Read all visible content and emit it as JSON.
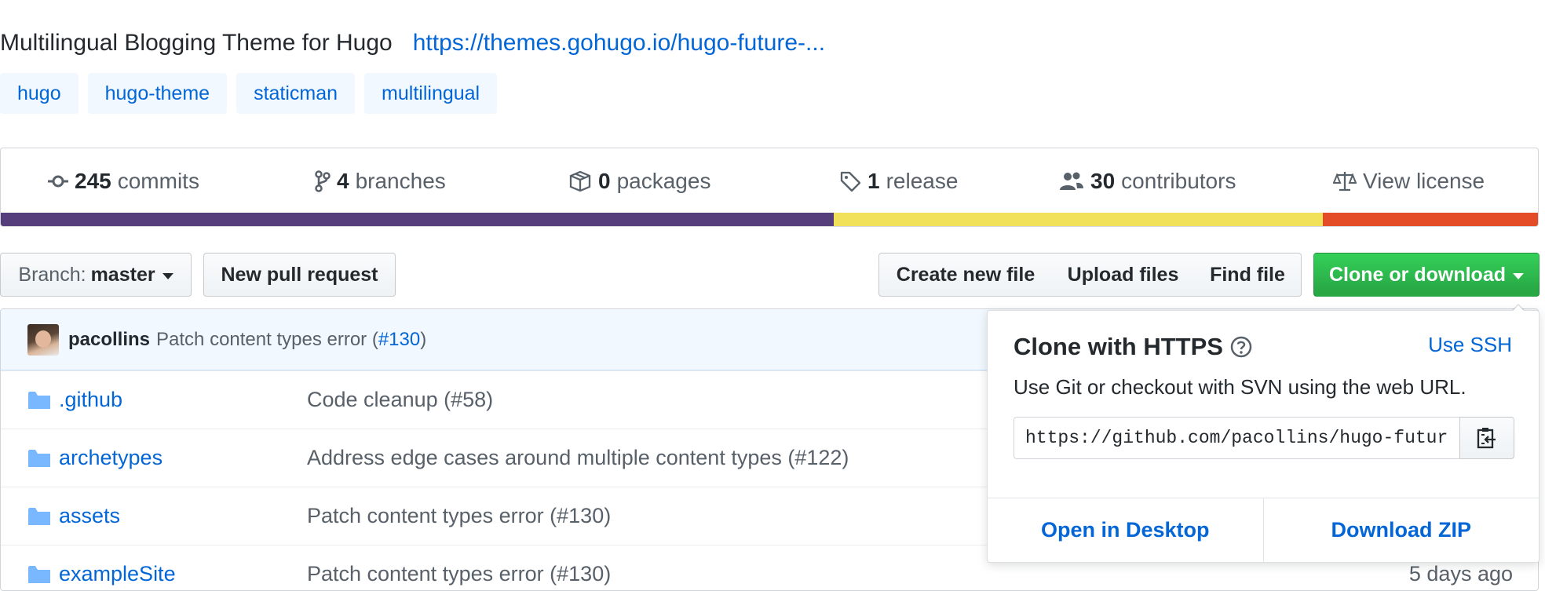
{
  "repo": {
    "description": "Multilingual Blogging Theme for Hugo",
    "website": "https://themes.gohugo.io/hugo-future-..."
  },
  "topics": [
    "hugo",
    "hugo-theme",
    "staticman",
    "multilingual"
  ],
  "summary": {
    "commits": {
      "count": "245",
      "label": "commits"
    },
    "branches": {
      "count": "4",
      "label": "branches"
    },
    "packages": {
      "count": "0",
      "label": "packages"
    },
    "releases": {
      "count": "1",
      "label": "release"
    },
    "contributors": {
      "count": "30",
      "label": "contributors"
    },
    "license": {
      "label": "View license"
    }
  },
  "language_bar": [
    {
      "color": "#563d7c",
      "percent": 54.2
    },
    {
      "color": "#f1e05a",
      "percent": 31.8
    },
    {
      "color": "#e34c26",
      "percent": 14.0
    }
  ],
  "toolbar": {
    "branch_prefix": "Branch:",
    "branch_name": "master",
    "new_pull_request": "New pull request",
    "create_new_file": "Create new file",
    "upload_files": "Upload files",
    "find_file": "Find file",
    "clone_or_download": "Clone or download"
  },
  "latest_commit": {
    "author": "pacollins",
    "message": "Patch content types error (",
    "pr_link": "#130",
    "message_end": ")"
  },
  "files": [
    {
      "name": ".github",
      "message": "Code cleanup (#58)",
      "age": ""
    },
    {
      "name": "archetypes",
      "message": "Address edge cases around multiple content types (#122)",
      "age": ""
    },
    {
      "name": "assets",
      "message": "Patch content types error (#130)",
      "age": ""
    },
    {
      "name": "exampleSite",
      "message": "Patch content types error (#130)",
      "age": "5 days ago"
    }
  ],
  "clone_dropdown": {
    "title": "Clone with HTTPS",
    "use_ssh": "Use SSH",
    "help": "Use Git or checkout with SVN using the web URL.",
    "url": "https://github.com/pacollins/hugo-future-imperfect-slim.git",
    "open_desktop": "Open in Desktop",
    "download_zip": "Download ZIP"
  }
}
